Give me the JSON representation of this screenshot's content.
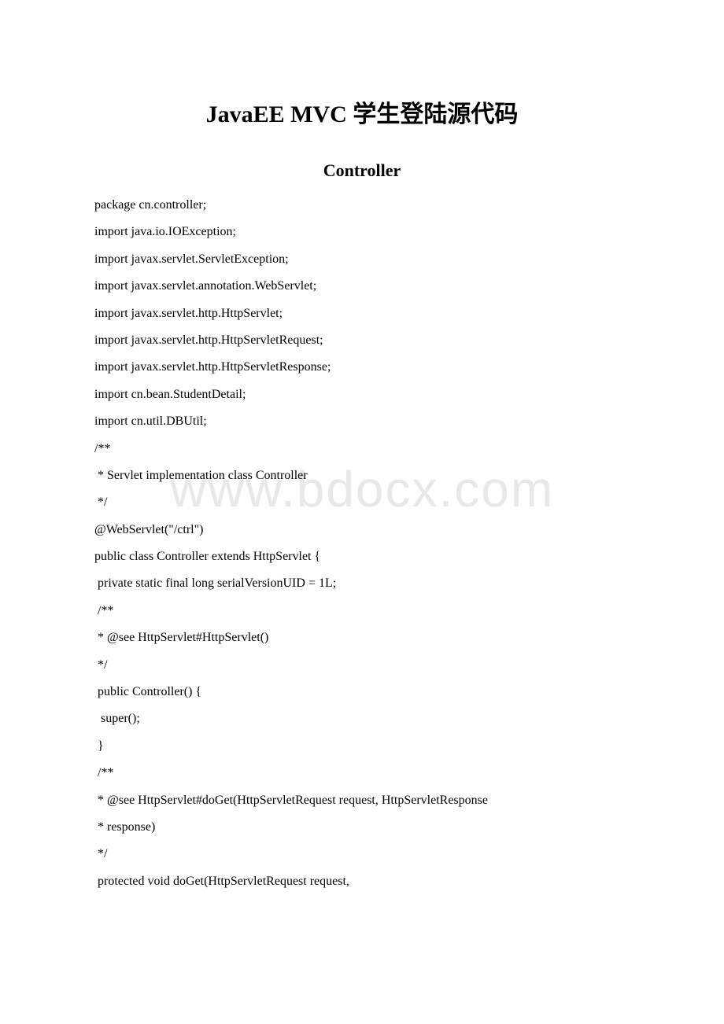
{
  "watermark": "www.bdocx.com",
  "title": "JavaEE MVC 学生登陆源代码",
  "subtitle": "Controller",
  "lines": [
    "package cn.controller;",
    "import java.io.IOException;",
    "import javax.servlet.ServletException;",
    "import javax.servlet.annotation.WebServlet;",
    "import javax.servlet.http.HttpServlet;",
    "import javax.servlet.http.HttpServletRequest;",
    "import javax.servlet.http.HttpServletResponse;",
    "import cn.bean.StudentDetail;",
    "import cn.util.DBUtil;",
    "/**",
    " * Servlet implementation class Controller",
    " */",
    "@WebServlet(\"/ctrl\")",
    "public class Controller extends HttpServlet {",
    " private static final long serialVersionUID = 1L;",
    " /**",
    " * @see HttpServlet#HttpServlet()",
    " */",
    " public Controller() {",
    "  super();",
    " }",
    " /**",
    " * @see HttpServlet#doGet(HttpServletRequest request, HttpServletResponse",
    " * response)",
    " */",
    " protected void doGet(HttpServletRequest request,"
  ]
}
